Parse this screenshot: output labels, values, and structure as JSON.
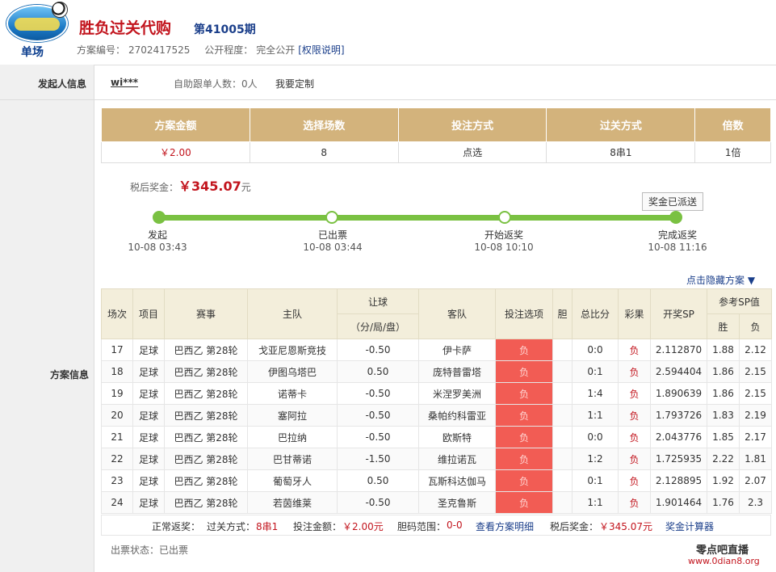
{
  "header": {
    "logo_text": "单场",
    "title": "胜负过关代购",
    "issue": "第41005期",
    "plan_no_label": "方案编号：",
    "plan_no": "2702417525",
    "visibility_label": "公开程度：",
    "visibility": "完全公开",
    "permission_link": "[权限说明]"
  },
  "labels": {
    "sponsor": "发起人信息",
    "plan": "方案信息"
  },
  "sponsor": {
    "name": "wi***",
    "auto_follow": "自助跟单人数：0人",
    "custom": "我要定制"
  },
  "summary": {
    "headers": [
      "方案金额",
      "选择场数",
      "投注方式",
      "过关方式",
      "倍数"
    ],
    "values": [
      "￥2.00",
      "8",
      "点选",
      "8串1",
      "1倍"
    ]
  },
  "tax": {
    "label": "税后奖金：",
    "amount": "￥345.07",
    "unit": "元"
  },
  "dispatched_btn": "奖金已派送",
  "progress": {
    "fraction": 1.0,
    "steps": [
      {
        "label": "发起",
        "time": "10-08 03:43"
      },
      {
        "label": "已出票",
        "time": "10-08 03:44"
      },
      {
        "label": "开始返奖",
        "time": "10-08 10:10"
      },
      {
        "label": "完成返奖",
        "time": "10-08 11:16"
      }
    ]
  },
  "hide_link": "点击隐藏方案 ▼",
  "detail": {
    "headers": {
      "no": "场次",
      "type": "项目",
      "league": "赛事",
      "home": "主队",
      "handicap": "让球",
      "handicap_sub": "（分/局/盘）",
      "away": "客队",
      "pick": "投注选项",
      "banker": "胆",
      "score": "总比分",
      "result": "彩果",
      "sp": "开奖SP",
      "ref_sp": "参考SP值",
      "win": "胜",
      "lose": "负"
    },
    "rows": [
      {
        "no": "17",
        "type": "足球",
        "league": "巴西乙 第28轮",
        "home": "戈亚尼恩斯竞技",
        "handicap": "-0.50",
        "away": "伊卡萨",
        "pick": "负",
        "banker": "",
        "score": "0:0",
        "result": "负",
        "sp": "2.112870",
        "win": "1.88",
        "lose": "2.12"
      },
      {
        "no": "18",
        "type": "足球",
        "league": "巴西乙 第28轮",
        "home": "伊图乌塔巴",
        "handicap": "0.50",
        "away": "庞特普雷塔",
        "pick": "负",
        "banker": "",
        "score": "0:1",
        "result": "负",
        "sp": "2.594404",
        "win": "1.86",
        "lose": "2.15"
      },
      {
        "no": "19",
        "type": "足球",
        "league": "巴西乙 第28轮",
        "home": "诺蒂卡",
        "handicap": "-0.50",
        "away": "米涅罗美洲",
        "pick": "负",
        "banker": "",
        "score": "1:4",
        "result": "负",
        "sp": "1.890639",
        "win": "1.86",
        "lose": "2.15"
      },
      {
        "no": "20",
        "type": "足球",
        "league": "巴西乙 第28轮",
        "home": "塞阿拉",
        "handicap": "-0.50",
        "away": "桑帕约科雷亚",
        "pick": "负",
        "banker": "",
        "score": "1:1",
        "result": "负",
        "sp": "1.793726",
        "win": "1.83",
        "lose": "2.19"
      },
      {
        "no": "21",
        "type": "足球",
        "league": "巴西乙 第28轮",
        "home": "巴拉纳",
        "handicap": "-0.50",
        "away": "欧斯特",
        "pick": "负",
        "banker": "",
        "score": "0:0",
        "result": "负",
        "sp": "2.043776",
        "win": "1.85",
        "lose": "2.17"
      },
      {
        "no": "22",
        "type": "足球",
        "league": "巴西乙 第28轮",
        "home": "巴甘蒂诺",
        "handicap": "-1.50",
        "away": "维拉诺瓦",
        "pick": "负",
        "banker": "",
        "score": "1:2",
        "result": "负",
        "sp": "1.725935",
        "win": "2.22",
        "lose": "1.81"
      },
      {
        "no": "23",
        "type": "足球",
        "league": "巴西乙 第28轮",
        "home": "葡萄牙人",
        "handicap": "0.50",
        "away": "瓦斯科达伽马",
        "pick": "负",
        "banker": "",
        "score": "0:1",
        "result": "负",
        "sp": "2.128895",
        "win": "1.92",
        "lose": "2.07"
      },
      {
        "no": "24",
        "type": "足球",
        "league": "巴西乙 第28轮",
        "home": "若茵维莱",
        "handicap": "-0.50",
        "away": "圣克鲁斯",
        "pick": "负",
        "banker": "",
        "score": "1:1",
        "result": "负",
        "sp": "1.901464",
        "win": "1.76",
        "lose": "2.3"
      }
    ]
  },
  "footer": {
    "normal_prize": "正常返奖：",
    "pass_label": "过关方式：",
    "pass_value": "8串1",
    "bet_label": "投注金额：",
    "bet_value": "￥2.00元",
    "banker_label": "胆码范围：",
    "banker_value": "0-0",
    "detail_link": "查看方案明细",
    "tax_label": "税后奖金：",
    "tax_value": "￥345.07元",
    "calc_link": "奖金计算器"
  },
  "ticket_status": "出票状态：已出票",
  "brand": {
    "name": "零点吧直播",
    "url": "www.0dian8.org"
  }
}
